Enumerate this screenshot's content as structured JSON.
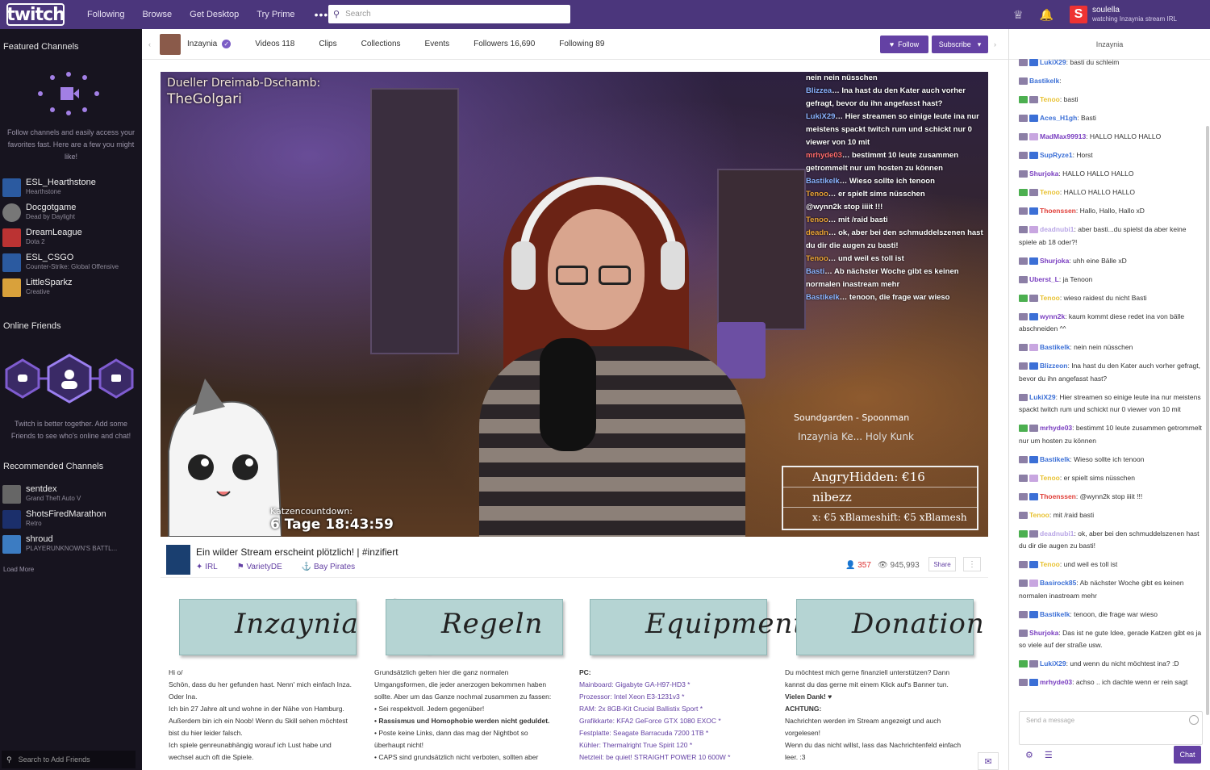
{
  "topnav": {
    "logo": "twitch",
    "links": [
      "Following",
      "Browse",
      "Get Desktop",
      "Try Prime"
    ],
    "more": "•••",
    "search_placeholder": "Search",
    "user_name": "soulella",
    "user_status": "watching Inzaynia stream IRL"
  },
  "leftbar": {
    "featured_title": "Featured Channels",
    "featured_desc": "Follow channels and easily access your favorites fast. Here are a few you might like!",
    "featured": [
      {
        "name": "ESL_Hearthstone",
        "game": "Hearthstone",
        "color": "#2b5aa0"
      },
      {
        "name": "Docgotgame",
        "game": "Dead by Daylight",
        "color": "#777"
      },
      {
        "name": "DreamLeague",
        "game": "Dota 2",
        "color": "#b33"
      },
      {
        "name": "ESL_CSGO",
        "game": "Counter-Strike: Global Offensive",
        "color": "#2b5aa0"
      },
      {
        "name": "LittleSparkz",
        "game": "Creative",
        "color": "#d9a13b"
      }
    ],
    "friends_title": "Online Friends",
    "friends_desc": "Twitch is better together. Add some Friends to see who's online and chat!",
    "recommended_title": "Recommended Channels",
    "recommended": [
      {
        "name": "sentdex",
        "game": "Grand Theft Auto V",
        "color": "#666"
      },
      {
        "name": "ShotsFiredMarathon",
        "game": "Retro",
        "color": "#1b2f6b"
      },
      {
        "name": "shroud",
        "game": "PLAYERUNKNOWN'S BATTL...",
        "color": "#3c7cc2"
      }
    ],
    "load_more": "Load More",
    "friend_search": "Search to Add Friends"
  },
  "channel_header": {
    "name": "Inzaynia",
    "tabs": [
      "Videos 118",
      "Clips",
      "Collections",
      "Events",
      "Followers 16,690",
      "Following 89"
    ],
    "follow": "Follow",
    "subscribe": "Subscribe"
  },
  "video": {
    "overlay_title_1": "Dueller Dreimab-Dschamb:",
    "overlay_title_2": "TheGolgari",
    "chat_lines": [
      {
        "user": "",
        "text": "nein nein nüsschen"
      },
      {
        "user": "Blizzea",
        "text": "Ina hast du den Kater auch vorher gefragt, bevor du ihn angefasst hast?"
      },
      {
        "user": "LukiX29",
        "text": "Hier streamen so einige leute ina nur meistens spackt twitch rum und schickt nur 0 viewer von 10 mit"
      },
      {
        "user": "mrhyde03",
        "text": "bestimmt 10 leute zusammen getrommelt nur um hosten zu können"
      },
      {
        "user": "Bastikelk",
        "text": "Wieso sollte ich tenoon"
      },
      {
        "user": "Tenoo",
        "text": "er spielt sims nüsschen"
      },
      {
        "user": "",
        "text": "@wynn2k stop iiiit !!!"
      },
      {
        "user": "Tenoo",
        "text": "mit /raid basti"
      },
      {
        "user": "deadn",
        "text": "ok, aber bei den schmuddelszenen hast du dir die augen zu basti!"
      },
      {
        "user": "Tenoo",
        "text": "und weil es toll ist"
      },
      {
        "user": "Basti",
        "text": "Ab nächster Woche gibt es keinen normalen inastream mehr"
      },
      {
        "user": "Bastikelk",
        "text": "tenoon, die frage war wieso"
      }
    ],
    "song": "Soundgarden - Spoonman",
    "social": "Inzaynia   Ke...   Holy Kunk",
    "donations": [
      "AngryHidden: €16",
      "nibezz",
      "x: €5  xBlameshift: €5  xBlamesh"
    ],
    "countdown_label": "Katzencountdown:",
    "countdown_value": "6 Tage 18:43:59"
  },
  "stream_info": {
    "title": "Ein wilder Stream erscheint plötzlich! | #inzifiert",
    "tags": [
      "IRL",
      "VarietyDE",
      "Bay Pirates"
    ],
    "viewers": "357",
    "views": "945,993",
    "share": "Share"
  },
  "panels": [
    {
      "title": "Inzaynia",
      "face": "#c0442c",
      "lines": [
        "Hi o/",
        "Schön, dass du her gefunden hast. Nenn' mich einfach Inza. Oder Ina.",
        "Ich bin 27 Jahre alt und wohne in der Nähe von Hamburg.",
        "Außerdem bin ich ein Noob! Wenn du Skill sehen möchtest bist du hier leider falsch.",
        "Ich spiele genreunabhängig worauf ich Lust habe und wechsel auch oft die Spiele."
      ]
    },
    {
      "title": "Regeln",
      "face": "#8a7f7a",
      "lines": [
        "Grundsätzlich gelten hier die ganz normalen Umgangsformen, die jeder anerzogen bekommen haben sollte. Aber um das Ganze nochmal zusammen zu fassen:",
        "• Sei respektvoll. Jedem gegenüber!",
        "• Rassismus und Homophobie werden nicht geduldet.",
        "• Poste keine Links, dann das mag der Nightbot so überhaupt nicht!",
        "• CAPS sind grundsätzlich nicht verboten, sollten aber"
      ]
    },
    {
      "title": "Equipment",
      "face": "#b3412c",
      "lines": [
        "PC:",
        "Mainboard: Gigabyte GA-H97-HD3 *",
        "Prozessor: Intel Xeon E3-1231v3 *",
        "RAM: 2x 8GB-Kit Crucial Ballistix Sport *",
        "Grafikkarte: KFA2 GeForce GTX 1080 EXOC *",
        "Festplatte: Seagate Barracuda 7200 1TB *",
        "Kühler: Thermalright True Spirit 120 *",
        "Netzteil: be quiet! STRAIGHT POWER 10 600W *"
      ]
    },
    {
      "title": "Donation",
      "face": "#c76a55",
      "lines": [
        "Du möchtest mich gerne finanziell unterstützen? Dann kannst du das gerne mit einem Klick auf's Banner tun.",
        "Vielen Dank! ♥",
        "ACHTUNG:",
        "Nachrichten werden im Stream angezeigt und auch vorgelesen!",
        "Wenn du das nicht willst, lass das Nachrichtenfeld einfach leer. :3"
      ]
    }
  ],
  "chat": {
    "header": "Inzaynia",
    "messages": [
      {
        "user": "LukiX29",
        "color": "#3b6fd6",
        "text": "basti du schleim"
      },
      {
        "user": "Bastikelk",
        "color": "#3b6fd6",
        "text": ""
      },
      {
        "user": "Tenoo",
        "color": "#e8c233",
        "text": "basti"
      },
      {
        "user": "Aces_H1gh",
        "color": "#3b6fd6",
        "text": "Basti"
      },
      {
        "user": "MadMax99913",
        "color": "#7a3fc0",
        "text": "HALLO HALLO HALLO"
      },
      {
        "user": "SupRyze1",
        "color": "#3b6fd6",
        "text": "Horst"
      },
      {
        "user": "Shurjoka",
        "color": "#7a3fc0",
        "text": "HALLO HALLO HALLO"
      },
      {
        "user": "Tenoo",
        "color": "#e8c233",
        "text": "HALLO HALLO HALLO"
      },
      {
        "user": "Thoenssen",
        "color": "#e0403a",
        "text": "Hallo, Hallo, Hallo xD"
      },
      {
        "user": "deadnubi1",
        "color": "#b9a6e6",
        "text": "aber basti...du spielst da aber keine spiele ab 18 oder?!"
      },
      {
        "user": "Shurjoka",
        "color": "#7a3fc0",
        "text": "uhh eine Bälle xD"
      },
      {
        "user": "Uberst_L",
        "color": "#7a3fc0",
        "text": "ja Tenoon"
      },
      {
        "user": "Tenoo",
        "color": "#e8c233",
        "text": "wieso raidest du nicht Basti"
      },
      {
        "user": "wynn2k",
        "color": "#7a3fc0",
        "text": "kaum kommt diese redet ina von bälle abschneiden ^^"
      },
      {
        "user": "Bastikelk",
        "color": "#3b6fd6",
        "text": "nein nein nüsschen"
      },
      {
        "user": "Blizzeon",
        "color": "#3b6fd6",
        "text": "Ina hast du den Kater auch vorher gefragt, bevor du ihn angefasst hast?"
      },
      {
        "user": "LukiX29",
        "color": "#3b6fd6",
        "text": "Hier streamen so einige leute ina nur meistens spackt twitch rum und schickt nur 0 viewer von 10 mit"
      },
      {
        "user": "mrhyde03",
        "color": "#7a3fc0",
        "text": "bestimmt 10 leute zusammen getrommelt nur um hosten zu können"
      },
      {
        "user": "Bastikelk",
        "color": "#3b6fd6",
        "text": "Wieso sollte ich tenoon"
      },
      {
        "user": "Tenoo",
        "color": "#e8c233",
        "text": "er spielt sims nüsschen"
      },
      {
        "user": "Thoenssen",
        "color": "#e0403a",
        "text": "@wynn2k stop iiiit !!!"
      },
      {
        "user": "Tenoo",
        "color": "#e8c233",
        "text": "mit /raid basti"
      },
      {
        "user": "deadnubi1",
        "color": "#b9a6e6",
        "text": "ok, aber bei den schmuddelszenen hast du dir die augen zu basti!"
      },
      {
        "user": "Tenoo",
        "color": "#e8c233",
        "text": "und weil es toll ist"
      },
      {
        "user": "Basirock85",
        "color": "#3b6fd6",
        "text": "Ab nächster Woche gibt es keinen normalen inastream mehr"
      },
      {
        "user": "Bastikelk",
        "color": "#3b6fd6",
        "text": "tenoon, die frage war wieso"
      },
      {
        "user": "Shurjoka",
        "color": "#7a3fc0",
        "text": "Das ist ne gute Idee, gerade Katzen gibt es ja so viele auf der straße usw."
      },
      {
        "user": "LukiX29",
        "color": "#3b6fd6",
        "text": "und wenn du nicht möchtest ina? :D"
      },
      {
        "user": "mrhyde03",
        "color": "#7a3fc0",
        "text": "achso .. ich dachte wenn er rein sagt"
      }
    ],
    "input_placeholder": "Send a message",
    "chat_button": "Chat"
  }
}
